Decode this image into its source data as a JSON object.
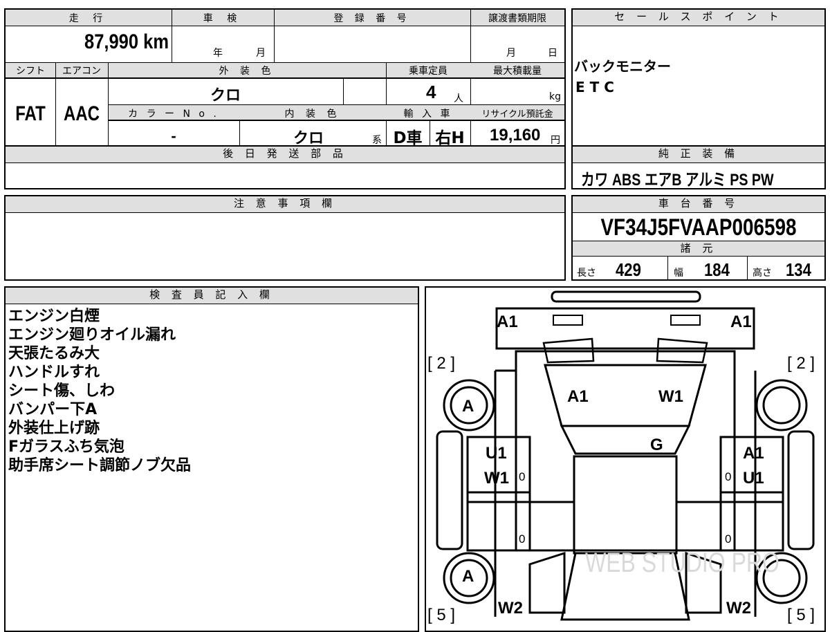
{
  "headers": {
    "mileage": "走 行",
    "inspection": "車 検",
    "registration_number": "登 録 番 号",
    "transfer_deadline": "譲渡書類期限",
    "shift": "シフト",
    "aircon": "エアコン",
    "exterior_color": "外 装 色",
    "capacity": "乗車定員",
    "max_load": "最大積載量",
    "color_no": "カ ラ ー N o .",
    "interior_color": "内 装 色",
    "import": "輸 入 車",
    "recycle_fee": "リサイクル預託金",
    "parts_later": "後 日 発 送 部 品",
    "sales_points": "セ ー ル ス ポ イ ン ト",
    "genuine_equipment": "純 正 装 備",
    "cautions": "注 意 事 項 欄",
    "chassis_number": "車 台 番 号",
    "specs": "諸 元",
    "inspector_notes": "検 査 員 記 入 欄"
  },
  "vehicle": {
    "mileage": "87,990",
    "mileage_unit": "km",
    "inspection_year_unit": "年",
    "inspection_month_unit": "月",
    "deadline_month_unit": "月",
    "deadline_day_unit": "日",
    "shift": "FAT",
    "aircon": "AAC",
    "exterior_color": "クロ",
    "capacity": "4",
    "capacity_unit": "人",
    "max_load_unit": "kg",
    "color_no": "-",
    "interior_color": "クロ",
    "interior_suffix": "系",
    "import_type": "D車",
    "steering": "右H",
    "recycle_fee": "19,160",
    "recycle_unit": "円",
    "chassis_number": "VF34J5FVAAP006598",
    "length_label": "長さ",
    "length": "429",
    "width_label": "幅",
    "width": "184",
    "height_label": "高さ",
    "height": "134"
  },
  "sales_points": [
    "バックモニター",
    "E T C"
  ],
  "genuine_equipment": "カワ ABS エアB アルミ PS PW",
  "inspector_notes": [
    "エンジン白煙",
    "エンジン廻りオイル漏れ",
    "天張たるみ大",
    "ハンドルすれ",
    "シート傷、しわ",
    "バンパー下A",
    "外装仕上げ跡",
    "Fガラスふち気泡",
    "助手席シート調節ノブ欠品"
  ],
  "diagram": {
    "top_left": "A1",
    "top_right": "A1",
    "bracket_tl": "[ 2 ]",
    "bracket_tr": "[ 2 ]",
    "bracket_bl": "[ 5 ]",
    "bracket_br": "[ 5 ]",
    "windshield_left": "A1",
    "windshield_right": "W1",
    "hood_g": "G",
    "left_front_u1": "U1",
    "left_front_w1": "W1",
    "right_front_a1": "A1",
    "right_front_u1": "U1",
    "wheel_fl": "A",
    "wheel_rl": "A",
    "rear_left": "W2",
    "rear_right": "W2",
    "zero": "0",
    "watermark": "WEB STUDIO PRO"
  }
}
